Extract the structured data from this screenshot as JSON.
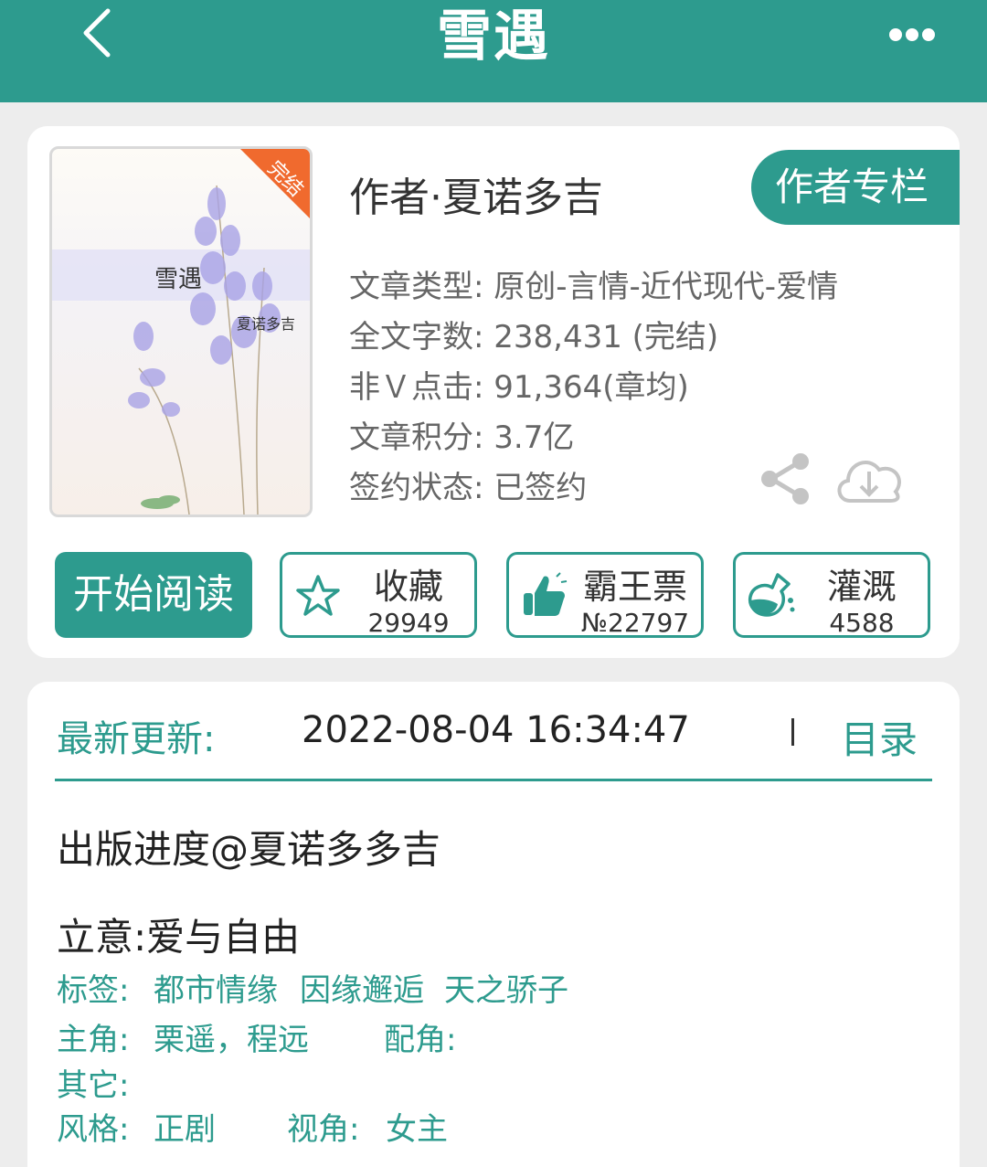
{
  "header": {
    "title": "雪遇",
    "back_icon": "chevron-left-icon",
    "more_icon": "more-dots-icon"
  },
  "book": {
    "cover_title": "雪遇",
    "cover_author": "夏诺多吉",
    "cover_badge": "完结",
    "author_line": "作者·夏诺多吉",
    "author_column_button": "作者专栏",
    "info": [
      "文章类型: 原创-言情-近代现代-爱情",
      "全文字数: 238,431 (完结)",
      "非Ｖ点击: 91,364(章均)",
      "文章积分: 3.7亿",
      "签约状态:  已签约"
    ]
  },
  "actions": {
    "read_button": "开始阅读",
    "favorite": {
      "label": "收藏",
      "count": "29949",
      "icon": "star-icon"
    },
    "ticket": {
      "label": "霸王票",
      "count": "№22797",
      "icon": "thumbs-up-icon"
    },
    "nutrient": {
      "label": "灌溉",
      "count": "4588",
      "icon": "flask-icon"
    }
  },
  "update": {
    "label": "最新更新:",
    "time": "2022-08-04 16:34:47",
    "toc_button": "目录"
  },
  "detail": {
    "latest_chapter": "出版进度@夏诺多多吉",
    "theme": "立意:爱与自由",
    "tags_label": "标签:",
    "tags": [
      "都市情缘",
      "因缘邂逅",
      "天之骄子"
    ],
    "protagonist_label": "主角:",
    "protagonist": "栗遥，程远",
    "supporting_label": "配角:",
    "other_label": "其它:",
    "style_label": "风格:",
    "style": "正剧",
    "perspective_label": "视角:",
    "perspective": "女主"
  },
  "colors": {
    "accent": "#2d9b8e",
    "background": "#ededed",
    "badge": "#f06a2e"
  }
}
